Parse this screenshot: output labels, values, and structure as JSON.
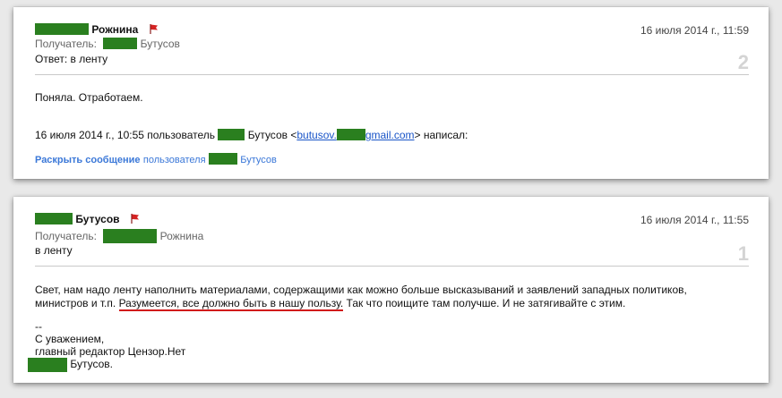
{
  "messages": [
    {
      "sender_last": "Рожнина",
      "date": "16 июля 2014 г., 11:59",
      "recipient_label": "Получатель:",
      "recipient_last": "Бутусов",
      "subject": "Ответ: в ленту",
      "number": "2",
      "body": "Поняла. Отработаем.",
      "quote_prefix": "16 июля 2014 г., 10:55 пользователь",
      "quote_name": "Бутусов",
      "email_pre": "butusov.",
      "email_post": "gmail.com",
      "quote_suffix": "написал:",
      "expand_bold": "Раскрыть сообщение",
      "expand_rest": "пользователя",
      "expand_name": "Бутусов"
    },
    {
      "sender_last": "Бутусов",
      "date": "16 июля 2014 г., 11:55",
      "recipient_label": "Получатель:",
      "recipient_last": "Рожнина",
      "subject": "в ленту",
      "number": "1",
      "body_line1": "Свет, нам надо ленту наполнить материалами, содержащими как можно больше высказываний и заявлений западных политиков,",
      "body_line2_pre": "министров и т.п.",
      "body_line2_underlined": "Разумеется, все должно быть в нашу пользу.",
      "body_line2_post": "Так что поищите там получше. И не затягивайте с этим.",
      "signature_dash": "--",
      "signature_greeting": "С уважением,",
      "signature_title": "главный редактор Цензор.Нет",
      "signature_name": "Бутусов."
    }
  ],
  "colors": {
    "redaction": "#2a7f1f",
    "flag": "#d42323",
    "link": "#1a55c8",
    "underline": "#d11b1b"
  }
}
